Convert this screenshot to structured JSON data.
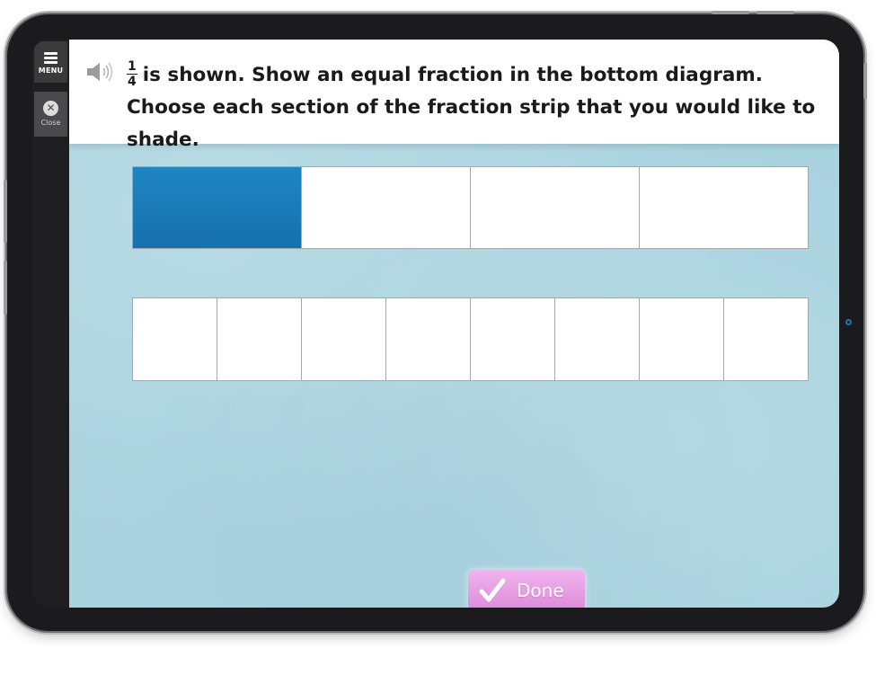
{
  "sidebar": {
    "menu_label": "MENU",
    "close_label": "Close"
  },
  "question": {
    "fraction": {
      "numerator": "1",
      "denominator": "4"
    },
    "text": "is shown. Show an equal fraction in the bottom diagram. Choose each section of the fraction strip that you would like to shade."
  },
  "top_strip": {
    "parts": 4,
    "shaded": 1,
    "fill_color": "#1b7dbd"
  },
  "bottom_strip": {
    "parts": 8,
    "shaded": 0
  },
  "done_button": {
    "label": "Done",
    "color": "#e39be0"
  },
  "icons": {
    "menu": "hamburger-icon",
    "close": "close-icon",
    "audio": "speaker-icon",
    "done": "checkmark-icon"
  }
}
